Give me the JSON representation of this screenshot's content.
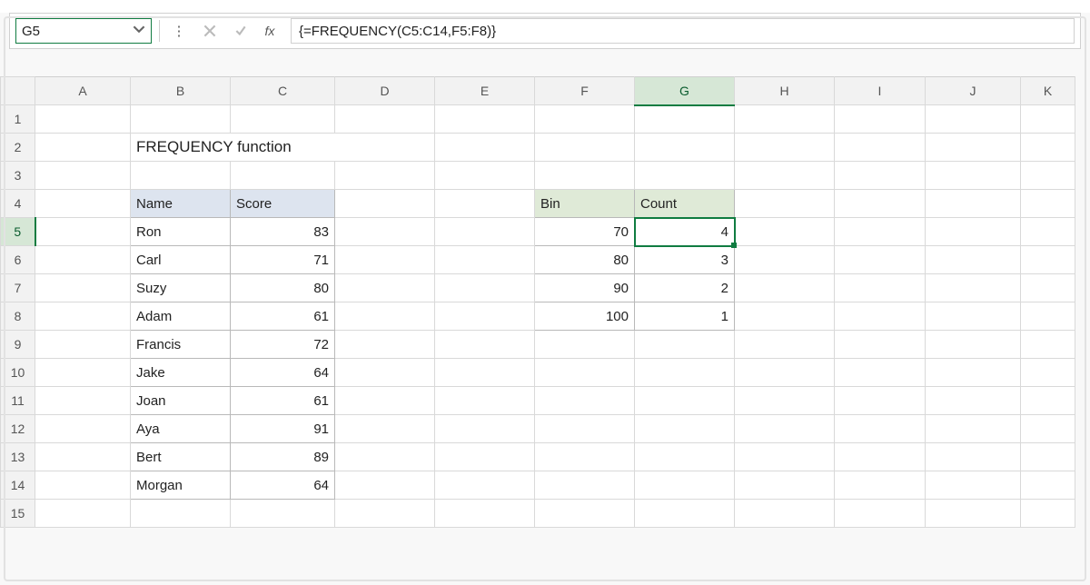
{
  "formula_bar": {
    "cell_ref": "G5",
    "formula": "{=FREQUENCY(C5:C14,F5:F8)}",
    "fx_label": "fx"
  },
  "columns": [
    "A",
    "B",
    "C",
    "D",
    "E",
    "F",
    "G",
    "H",
    "I",
    "J",
    "K"
  ],
  "row_numbers": [
    "1",
    "2",
    "3",
    "4",
    "5",
    "6",
    "7",
    "8",
    "9",
    "10",
    "11",
    "12",
    "13",
    "14",
    "15"
  ],
  "active_col": "G",
  "active_row": "5",
  "title_cell": "FREQUENCY function",
  "name_score": {
    "headers": {
      "name": "Name",
      "score": "Score"
    },
    "rows": [
      {
        "name": "Ron",
        "score": "83"
      },
      {
        "name": "Carl",
        "score": "71"
      },
      {
        "name": "Suzy",
        "score": "80"
      },
      {
        "name": "Adam",
        "score": "61"
      },
      {
        "name": "Francis",
        "score": "72"
      },
      {
        "name": "Jake",
        "score": "64"
      },
      {
        "name": "Joan",
        "score": "61"
      },
      {
        "name": "Aya",
        "score": "91"
      },
      {
        "name": "Bert",
        "score": "89"
      },
      {
        "name": "Morgan",
        "score": "64"
      }
    ]
  },
  "bin_count": {
    "headers": {
      "bin": "Bin",
      "count": "Count"
    },
    "rows": [
      {
        "bin": "70",
        "count": "4"
      },
      {
        "bin": "80",
        "count": "3"
      },
      {
        "bin": "90",
        "count": "2"
      },
      {
        "bin": "100",
        "count": "1"
      }
    ]
  },
  "selected_cell_value": "4"
}
